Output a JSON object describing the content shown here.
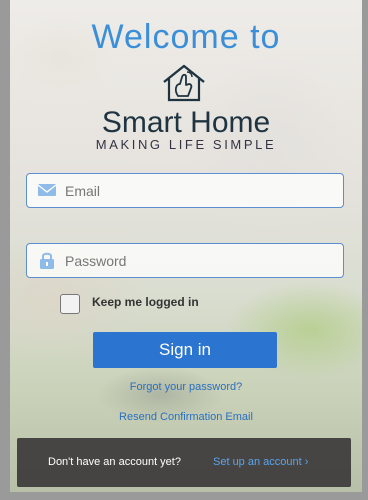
{
  "header": {
    "welcome": "Welcome to",
    "brand": "Smart Home",
    "tagline": "MAKING LIFE SIMPLE"
  },
  "form": {
    "email_placeholder": "Email",
    "password_placeholder": "Password",
    "keep_logged_in_label": "Keep me logged in",
    "sign_in_label": "Sign in",
    "forgot_password": "Forgot your password?",
    "resend_confirmation": "Resend Confirmation Email"
  },
  "banner": {
    "question": "Don't have an account yet?",
    "link": "Set up an account ›"
  },
  "icons": {
    "email": "envelope-icon",
    "password": "lock-icon",
    "logo": "house-hand-icon"
  },
  "colors": {
    "accent": "#3a8fd8",
    "button": "#2b74d0",
    "link": "#2a6fbf"
  }
}
